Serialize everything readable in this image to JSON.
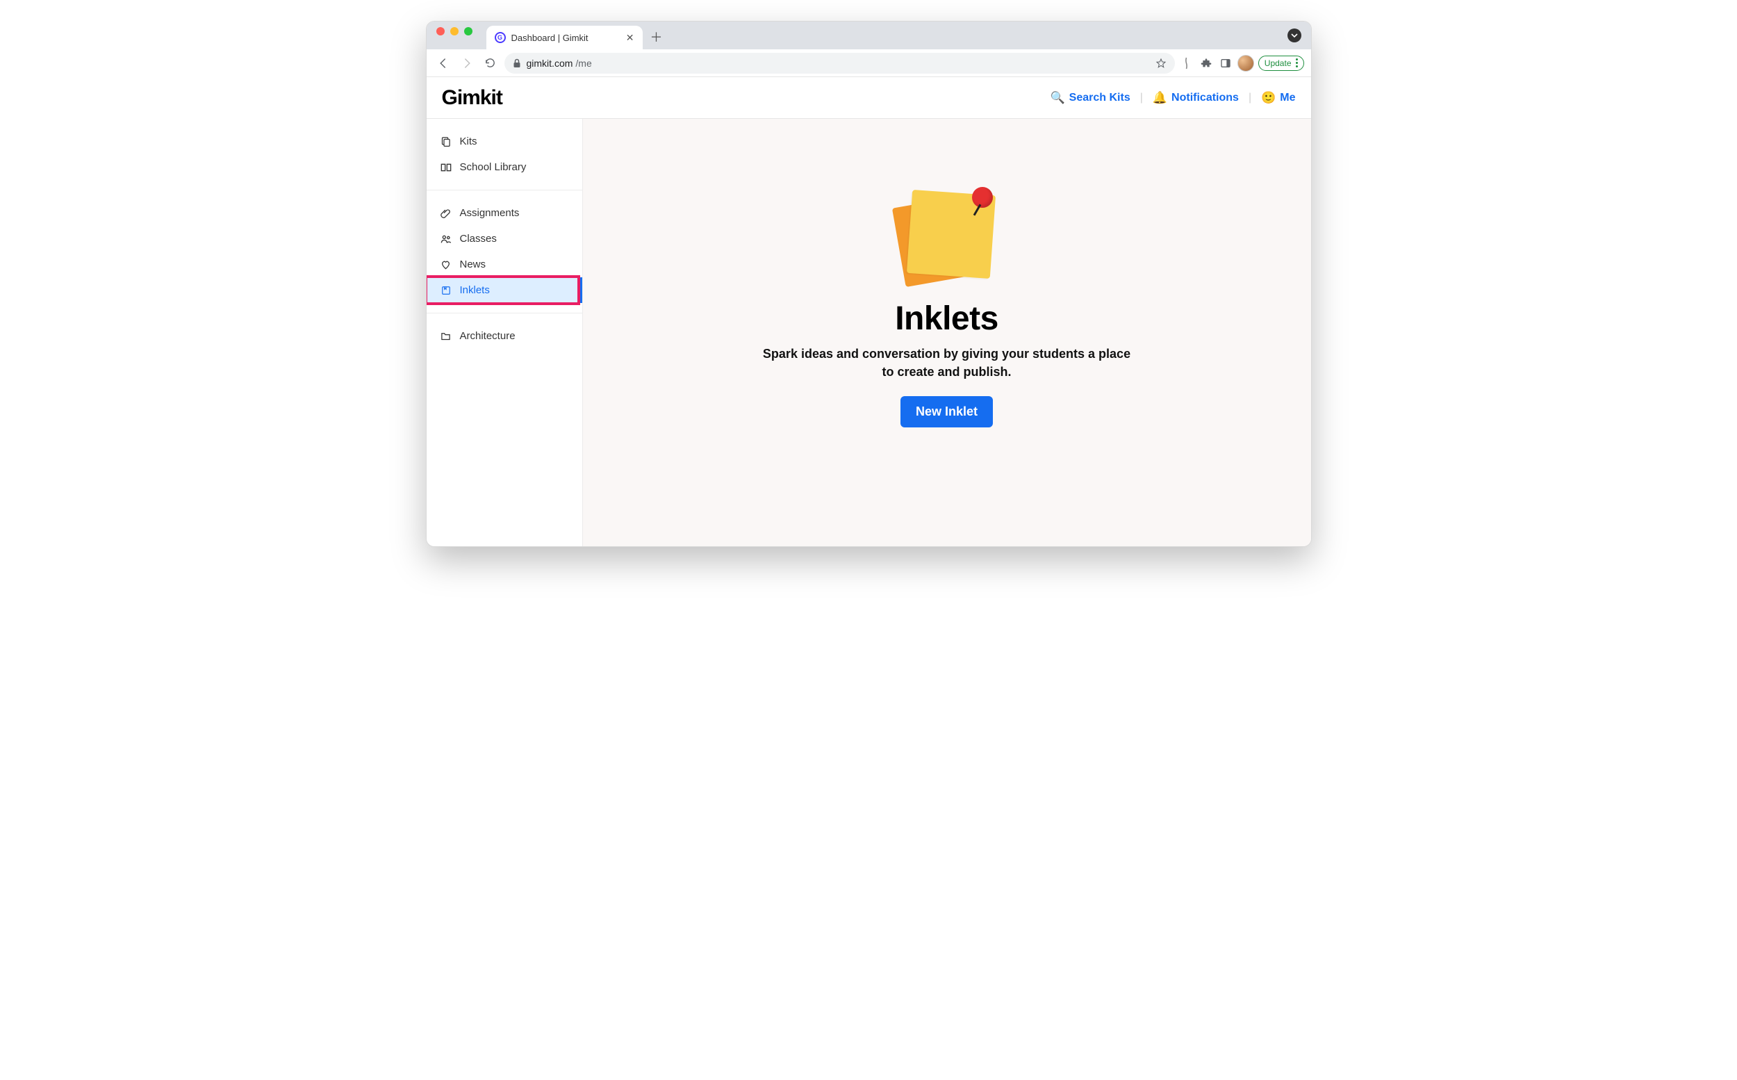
{
  "browser": {
    "tab_title": "Dashboard | Gimkit",
    "url_host": "gimkit.com",
    "url_path": "/me",
    "update_label": "Update"
  },
  "header": {
    "logo": "Gimkit",
    "search_label": "Search Kits",
    "notifications_label": "Notifications",
    "me_label": "Me"
  },
  "sidebar": {
    "group1": [
      {
        "icon": "kits-icon",
        "label": "Kits"
      },
      {
        "icon": "library-icon",
        "label": "School Library"
      }
    ],
    "group2": [
      {
        "icon": "clip-icon",
        "label": "Assignments"
      },
      {
        "icon": "people-icon",
        "label": "Classes"
      },
      {
        "icon": "heart-icon",
        "label": "News"
      },
      {
        "icon": "inklet-icon",
        "label": "Inklets",
        "active": true
      }
    ],
    "group3": [
      {
        "icon": "folder-icon",
        "label": "Architecture"
      }
    ]
  },
  "main": {
    "title": "Inklets",
    "subtitle": "Spark ideas and conversation by giving your students a place to create and publish.",
    "button_label": "New Inklet"
  }
}
